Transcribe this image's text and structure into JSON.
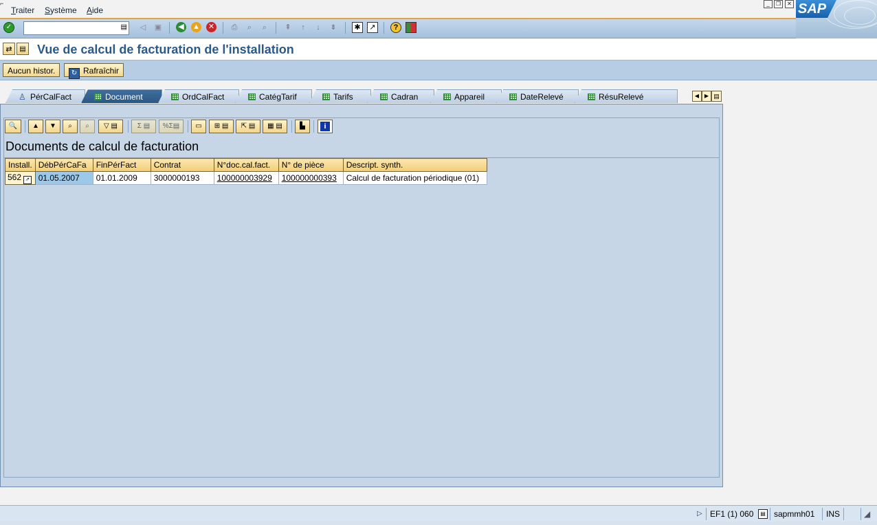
{
  "menu": {
    "items": [
      "Traiter",
      "Système",
      "Aide"
    ]
  },
  "sap_logo": "SAP",
  "command_field": {
    "value": ""
  },
  "title": "Vue de calcul de facturation de l'installation",
  "app_toolbar": {
    "no_history": "Aucun histor.",
    "refresh": "Rafraîchir"
  },
  "tabs": [
    {
      "label": "PérCalFact",
      "icon": "person-icon",
      "active": false
    },
    {
      "label": "Document",
      "icon": "table-icon",
      "active": true
    },
    {
      "label": "OrdCalFact",
      "icon": "table-icon",
      "active": false
    },
    {
      "label": "CatégTarif",
      "icon": "table-icon",
      "active": false
    },
    {
      "label": "Tarifs",
      "icon": "table-icon",
      "active": false
    },
    {
      "label": "Cadran",
      "icon": "table-icon",
      "active": false
    },
    {
      "label": "Appareil",
      "icon": "table-icon",
      "active": false
    },
    {
      "label": "DateRelevé",
      "icon": "table-icon",
      "active": false
    },
    {
      "label": "RésuRelevé",
      "icon": "table-icon",
      "active": false
    }
  ],
  "grid": {
    "title": "Documents de calcul de facturation",
    "columns": [
      "Install.",
      "DébPérCaFa",
      "FinPérFact",
      "Contrat",
      "N°doc.cal.fact.",
      "N° de pièce",
      "Descript. synth."
    ],
    "rows": [
      [
        "562",
        "01.05.2007",
        "01.01.2009",
        "3000000193",
        "100000003929",
        "100000000393",
        "Calcul de facturation périodique (01)"
      ]
    ]
  },
  "status": {
    "system": "EF1 (1) 060",
    "server": "sapmmh01",
    "mode": "INS"
  },
  "colors": {
    "title": "#2c5a88",
    "accent_line": "#e8a23a",
    "active_tab": "#2c5783",
    "selected_cell": "#9cc8ea"
  }
}
